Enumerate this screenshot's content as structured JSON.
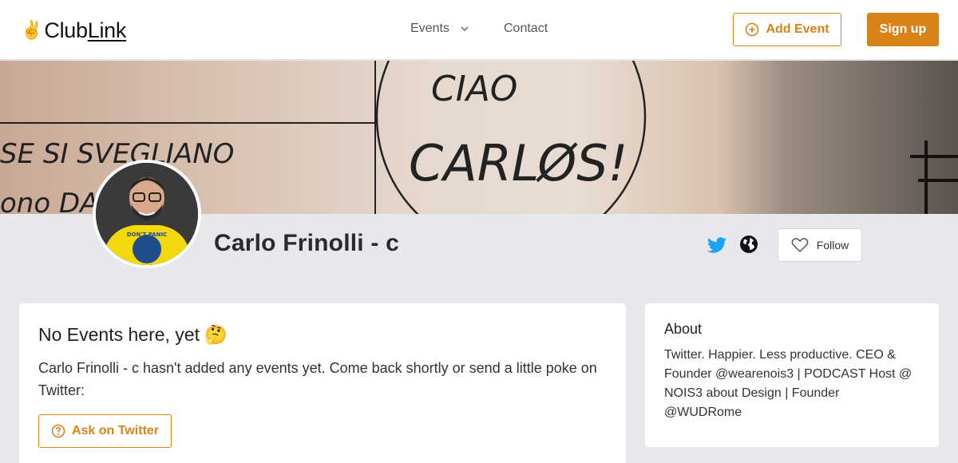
{
  "nav": {
    "logo_prefix": "Club",
    "logo_suffix": "Link",
    "events_label": "Events",
    "contact_label": "Contact",
    "add_event_label": "Add Event",
    "signup_label": "Sign up"
  },
  "cover": {
    "text_left": "SE SI SVEGLIANO",
    "text_left2": "ono DA   NSTO",
    "text_circle1": "CIAO",
    "text_circle2": "CARLØS!"
  },
  "profile": {
    "name": "Carlo Frinolli - c",
    "follow_label": "Follow",
    "avatar_shirt_text": "DON'T PANIC"
  },
  "events_card": {
    "title": "No Events here, yet",
    "title_emoji": "🤔",
    "message": "Carlo Frinolli - c hasn't added any events yet. Come back shortly or send a little poke on Twitter:",
    "ask_label": "Ask on Twitter"
  },
  "about_card": {
    "title": "About",
    "bio": "Twitter. Happier. Less productive. CEO & Founder @wearenois3 | PODCAST Host @ NOIS3 about Design | Founder @WUDRome"
  },
  "colors": {
    "accent": "#d9821a",
    "twitter": "#1da1f2",
    "page_bg": "#e6e8ec"
  },
  "icons": [
    "peace-hand-icon",
    "chevron-down-icon",
    "plus-circle-icon",
    "twitter-icon",
    "globe-icon",
    "heart-icon",
    "question-circle-icon"
  ]
}
